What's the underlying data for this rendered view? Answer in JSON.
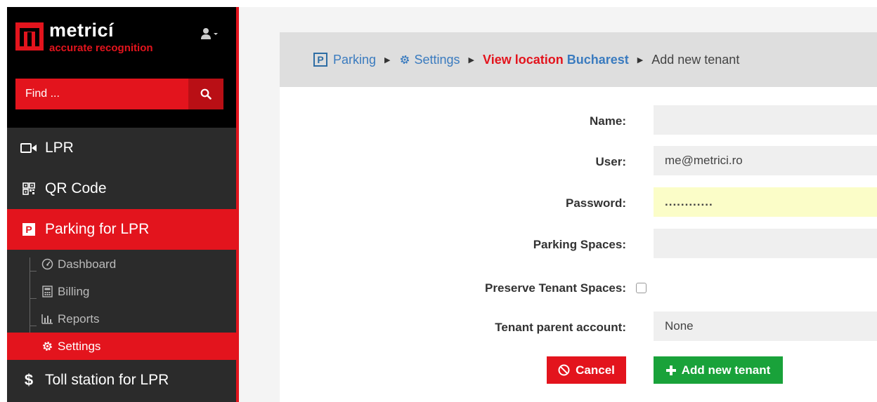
{
  "brand": {
    "name": "metricí",
    "tagline": "accurate recognition",
    "accent_color": "#e3141d"
  },
  "sidebar": {
    "find_placeholder": "Find ...",
    "menu": [
      {
        "label": "LPR",
        "icon": "video-camera-icon"
      },
      {
        "label": "QR Code",
        "icon": "qrcode-icon"
      },
      {
        "label": "Parking for LPR",
        "icon": "parking-icon",
        "active": true
      },
      {
        "label": "Toll station for LPR",
        "icon": "dollar-icon"
      }
    ],
    "submenu": [
      {
        "label": "Dashboard",
        "icon": "tachometer-icon"
      },
      {
        "label": "Billing",
        "icon": "calculator-icon"
      },
      {
        "label": "Reports",
        "icon": "bar-chart-icon"
      },
      {
        "label": "Settings",
        "icon": "gear-icon",
        "active": true
      }
    ]
  },
  "breadcrumb": {
    "parking_badge": "P",
    "parking": "Parking",
    "settings": "Settings",
    "view_location": "View location",
    "location": "Bucharest",
    "current": "Add new tenant"
  },
  "form": {
    "name_label": "Name:",
    "name_value": "",
    "user_label": "User:",
    "user_value": "me@metrici.ro",
    "password_label": "Password:",
    "password_value": "............",
    "parking_spaces_label": "Parking Spaces:",
    "parking_spaces_value": "",
    "preserve_label": "Preserve Tenant Spaces:",
    "preserve_checked": false,
    "parent_label": "Tenant parent account:",
    "parent_value": "None"
  },
  "buttons": {
    "cancel": "Cancel",
    "add": "Add new tenant",
    "cancel_color": "#e3141d",
    "add_color": "#19a23a"
  }
}
